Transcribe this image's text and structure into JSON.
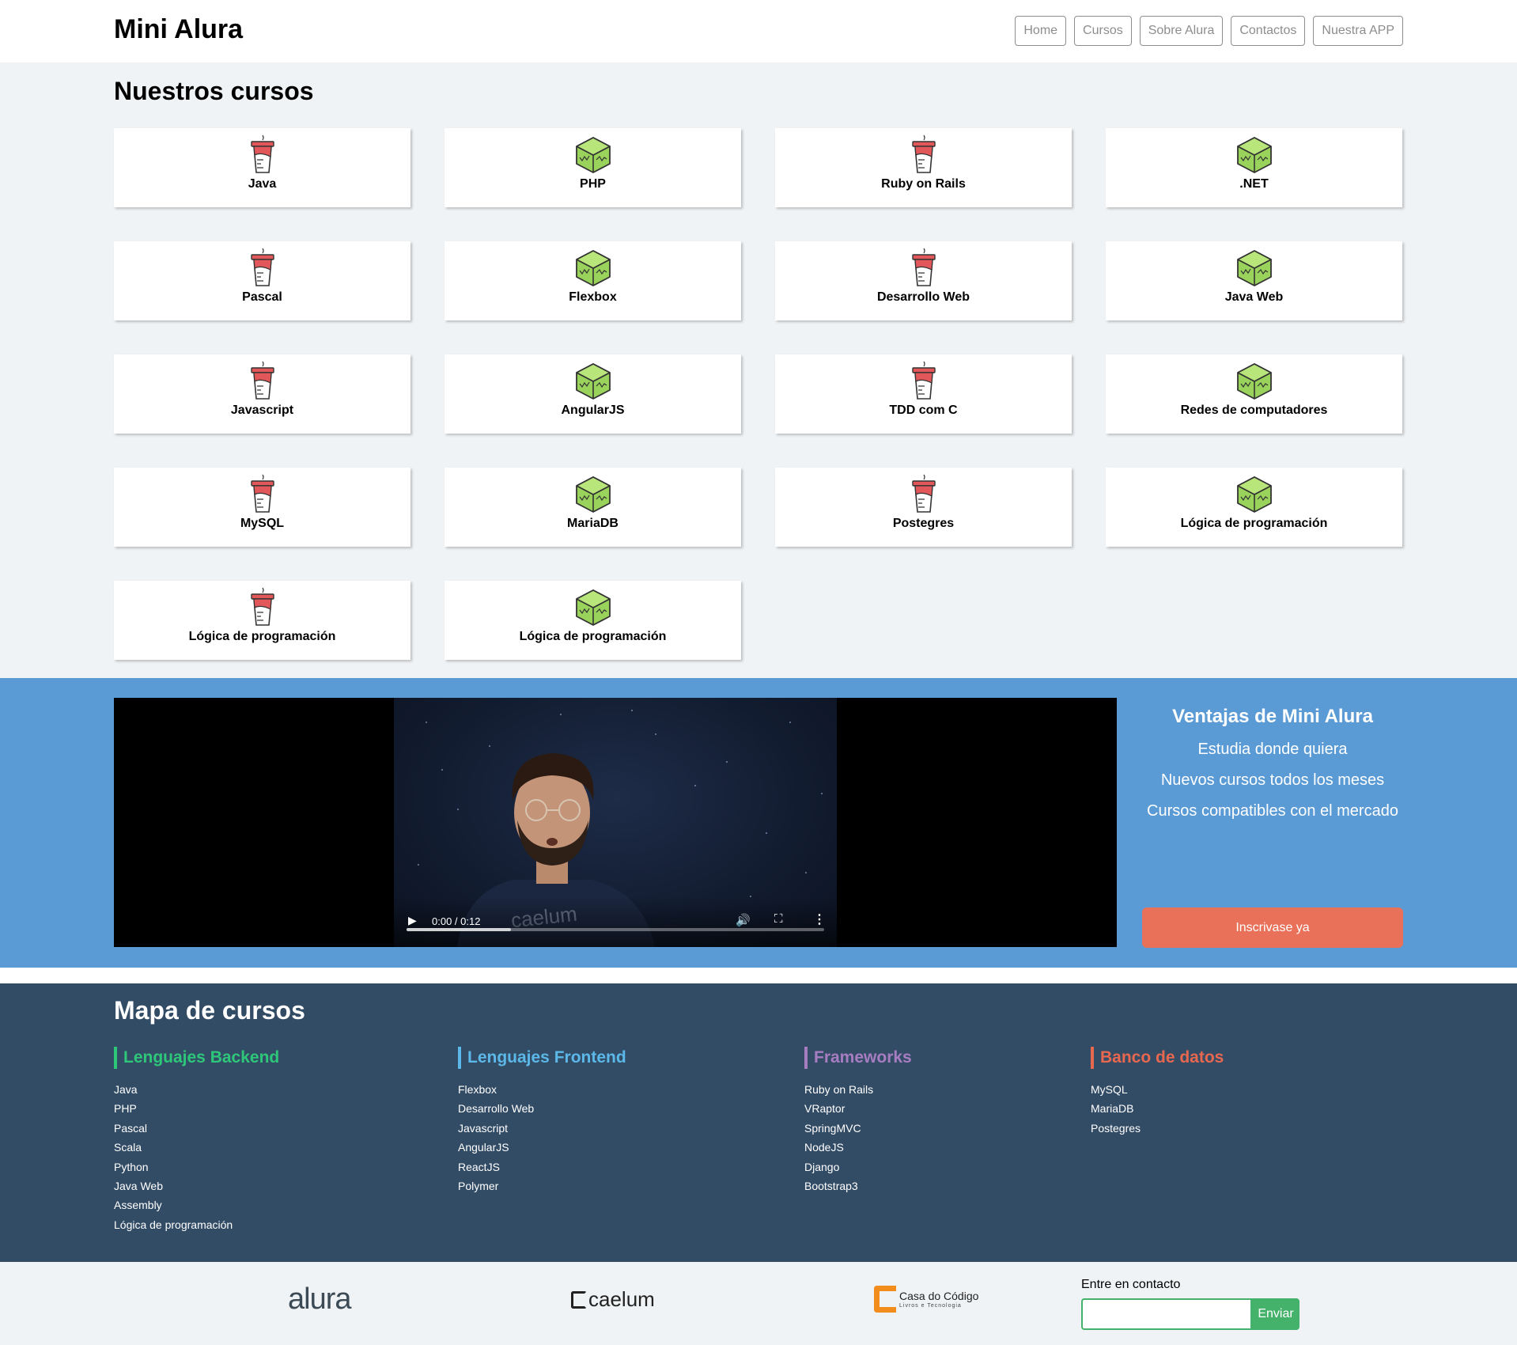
{
  "header": {
    "logo": "Mini Alura",
    "nav": [
      "Home",
      "Cursos",
      "Sobre Alura",
      "Contactos",
      "Nuestra APP"
    ]
  },
  "courses": {
    "title": "Nuestros cursos",
    "items": [
      {
        "label": "Java",
        "icon": "cup-icon"
      },
      {
        "label": "PHP",
        "icon": "cube-icon"
      },
      {
        "label": "Ruby on Rails",
        "icon": "cup-icon"
      },
      {
        "label": ".NET",
        "icon": "cube-icon"
      },
      {
        "label": "Pascal",
        "icon": "cup-icon"
      },
      {
        "label": "Flexbox",
        "icon": "cube-icon"
      },
      {
        "label": "Desarrollo Web",
        "icon": "cup-icon"
      },
      {
        "label": "Java Web",
        "icon": "cube-icon"
      },
      {
        "label": "Javascript",
        "icon": "cup-icon"
      },
      {
        "label": "AngularJS",
        "icon": "cube-icon"
      },
      {
        "label": "TDD com C",
        "icon": "cup-icon"
      },
      {
        "label": "Redes de computadores",
        "icon": "cube-icon"
      },
      {
        "label": "MySQL",
        "icon": "cup-icon"
      },
      {
        "label": "MariaDB",
        "icon": "cube-icon"
      },
      {
        "label": "Postegres",
        "icon": "cup-icon"
      },
      {
        "label": "Lógica de programación",
        "icon": "cube-icon"
      },
      {
        "label": "Lógica de programación",
        "icon": "cup-icon"
      },
      {
        "label": "Lógica de programación",
        "icon": "cube-icon"
      }
    ]
  },
  "video": {
    "time": "0:00 / 0:12",
    "progress": 0.25,
    "shirt_text": "caelum"
  },
  "advantages": {
    "title": "Ventajas de Mini Alura",
    "items": [
      "Estudia donde quiera",
      "Nuevos cursos todos los meses",
      "Cursos compatibles con el mercado"
    ],
    "button": "Inscrivase ya"
  },
  "map": {
    "title": "Mapa de cursos",
    "columns": [
      {
        "title": "Lenguajes Backend",
        "color": "#2ec77a",
        "items": [
          "Java",
          "PHP",
          "Pascal",
          "Scala",
          "Python",
          "Java Web",
          "Assembly",
          "Lógica de programación"
        ]
      },
      {
        "title": "Lenguajes Frontend",
        "color": "#5bb8e8",
        "items": [
          "Flexbox",
          "Desarrollo Web",
          "Javascript",
          "AngularJS",
          "ReactJS",
          "Polymer"
        ]
      },
      {
        "title": "Frameworks",
        "color": "#a77dc2",
        "items": [
          "Ruby on Rails",
          "VRaptor",
          "SpringMVC",
          "NodeJS",
          "Django",
          "Bootstrap3"
        ]
      },
      {
        "title": "Banco de datos",
        "color": "#e8674f",
        "items": [
          "MySQL",
          "MariaDB",
          "Postegres"
        ]
      }
    ]
  },
  "footer": {
    "brands": [
      "alura",
      "caelum",
      "Casa do Código",
      "Livros e Tecnologia"
    ],
    "contact_label": "Entre en contacto",
    "send": "Enviar"
  },
  "colors": {
    "primary_blue": "#5b9bd5",
    "dark_slate": "#334c66",
    "salmon": "#e97159",
    "green": "#44b26a",
    "light_bg": "#f0f3f5"
  }
}
